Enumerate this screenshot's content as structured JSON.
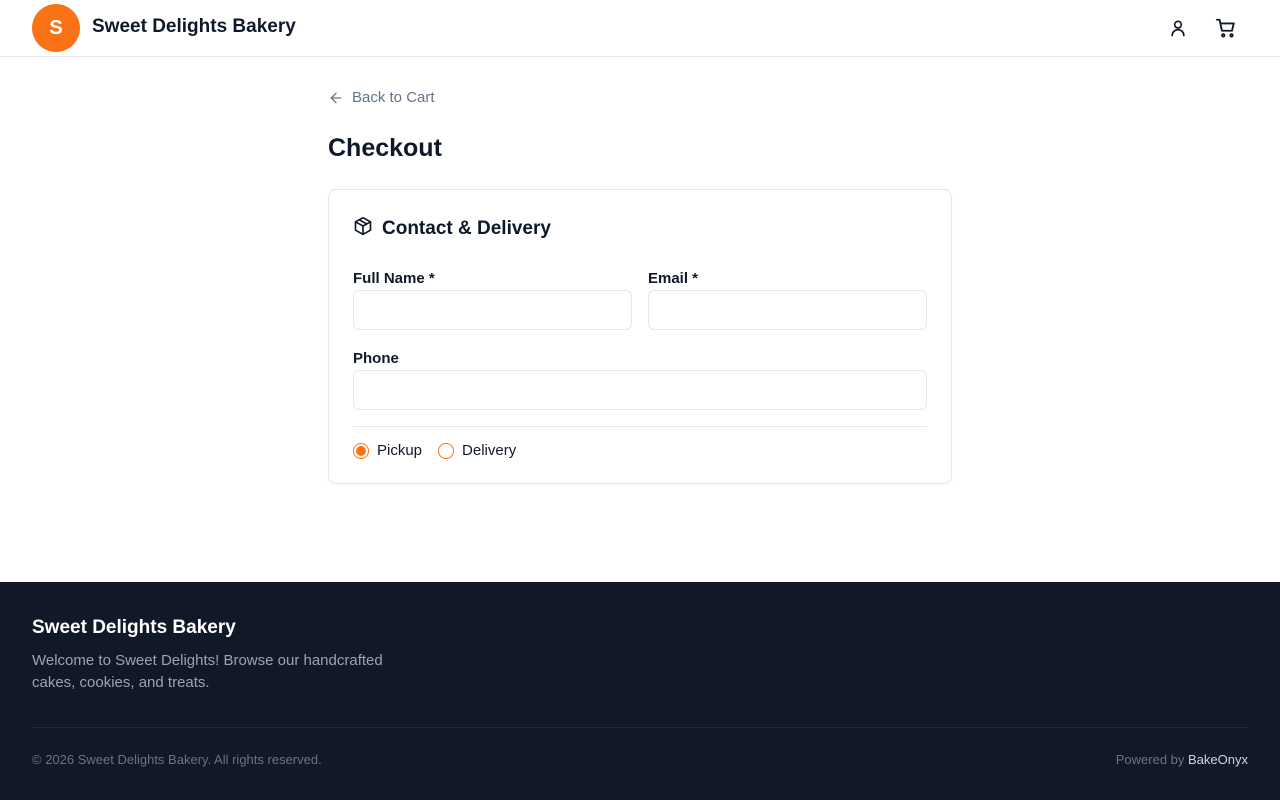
{
  "header": {
    "logo_letter": "S",
    "brand": "Sweet Delights Bakery",
    "icons": [
      "user-icon",
      "cart-icon"
    ]
  },
  "nav": {
    "back_label": "Back to Cart"
  },
  "page": {
    "title": "Checkout"
  },
  "card": {
    "title": "Contact & Delivery",
    "icon": "package-icon",
    "fields": {
      "full_name_label": "Full Name *",
      "full_name_value": "",
      "email_label": "Email *",
      "email_value": "",
      "phone_label": "Phone",
      "phone_value": ""
    },
    "fulfillment": {
      "options": [
        "Pickup",
        "Delivery"
      ],
      "selected": "Pickup",
      "pickup_label": "Pickup",
      "delivery_label": "Delivery"
    }
  },
  "footer": {
    "brand": "Sweet Delights Bakery",
    "description": "Welcome to Sweet Delights! Browse our handcrafted cakes, cookies, and treats.",
    "copyright": "© 2026 Sweet Delights Bakery. All rights reserved.",
    "powered_prefix": "Powered by ",
    "powered_link": "BakeOnyx"
  },
  "colors": {
    "accent": "#f97316",
    "footer_bg": "#111827",
    "border": "#e2e8f0"
  }
}
